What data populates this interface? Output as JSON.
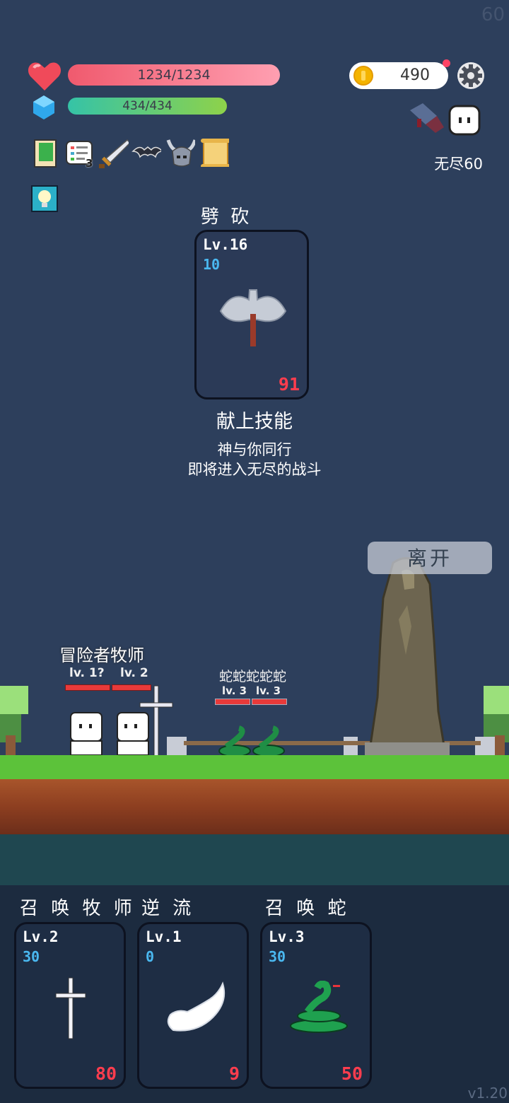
{
  "fps": "60",
  "player": {
    "hp_text": "1234/1234",
    "hp": 1.0,
    "mp_text": "434/434",
    "mp": 1.0
  },
  "gold": "490",
  "mode_label": "无尽60",
  "inventory_icons": [
    "note-card-icon",
    "checklist-icon",
    "sword-icon",
    "bat-icon",
    "horned-helmet-icon",
    "scroll-icon",
    "lightbulb-icon"
  ],
  "inventory_badge": "3",
  "offered_skill": {
    "name": "劈 砍",
    "level": "Lv.16",
    "cost": "10",
    "value": "91",
    "icon": "battle-axe-icon"
  },
  "offer": {
    "title": "献上技能",
    "line1": "神与你同行",
    "line2": "即将进入无尽的战斗"
  },
  "leave_label": "离开",
  "allies": {
    "label": "冒险者牧师",
    "lv1": "lv. 1?",
    "lv2": "lv. 2"
  },
  "enemies": {
    "label": "蛇蛇蛇蛇蛇",
    "lv1": "lv. 3",
    "lv2": "lv. 3"
  },
  "hand": [
    {
      "title": "召 唤 牧 师",
      "level": "Lv.2",
      "cost": "30",
      "value": "80",
      "icon": "cross-icon"
    },
    {
      "title": "逆 流",
      "level": "Lv.1",
      "cost": "0",
      "value": "9",
      "icon": "wing-icon"
    },
    {
      "title": "召 唤 蛇",
      "level": "Lv.3",
      "cost": "30",
      "value": "50",
      "icon": "snake-icon"
    }
  ],
  "version": "v1.20",
  "colors": {
    "background": "#2d3f5c",
    "hp": "#f05a6e",
    "mp": "#35c3a7",
    "damage": "#ff3d4e",
    "cost": "#4ab8f0"
  }
}
